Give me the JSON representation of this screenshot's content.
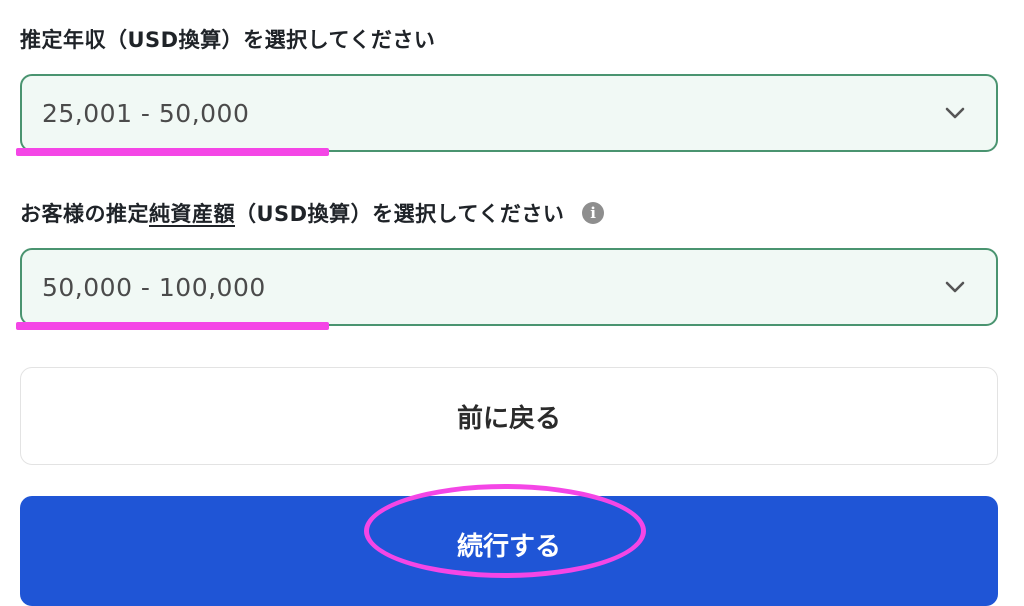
{
  "income": {
    "label": "推定年収（USD換算）を選択してください",
    "selected_value": "25,001 - 50,000",
    "icon": "chevron-down-icon"
  },
  "net_worth": {
    "label_prefix": "お客様の推定",
    "label_underlined": "純資産額",
    "label_suffix": "（USD換算）を選択してください",
    "info_icon_glyph": "i",
    "selected_value": "50,000 - 100,000",
    "icon": "chevron-down-icon"
  },
  "buttons": {
    "back_label": "前に戻る",
    "continue_label": "続行する"
  },
  "colors": {
    "highlight": "#f446e6",
    "select_border": "#4a9470",
    "select_bg": "#f1f9f5",
    "primary_button": "#1f55d6"
  }
}
